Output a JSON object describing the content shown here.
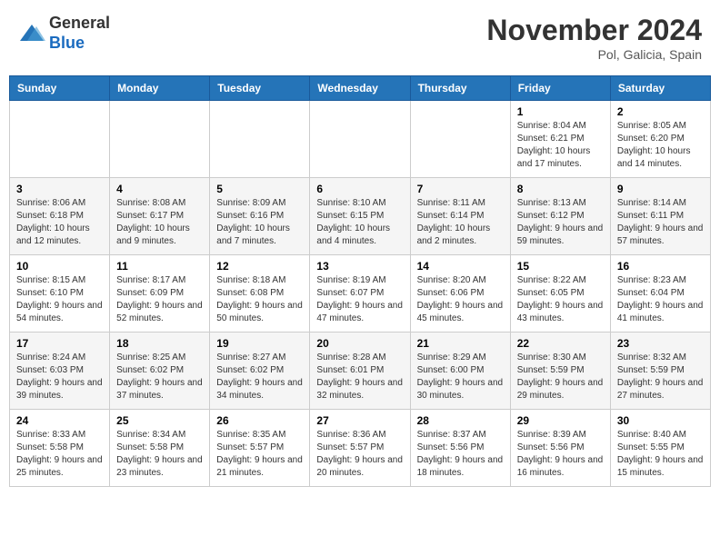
{
  "header": {
    "logo_line1": "General",
    "logo_line2": "Blue",
    "month_title": "November 2024",
    "location": "Pol, Galicia, Spain"
  },
  "weekdays": [
    "Sunday",
    "Monday",
    "Tuesday",
    "Wednesday",
    "Thursday",
    "Friday",
    "Saturday"
  ],
  "weeks": [
    [
      {
        "day": "",
        "info": ""
      },
      {
        "day": "",
        "info": ""
      },
      {
        "day": "",
        "info": ""
      },
      {
        "day": "",
        "info": ""
      },
      {
        "day": "",
        "info": ""
      },
      {
        "day": "1",
        "info": "Sunrise: 8:04 AM\nSunset: 6:21 PM\nDaylight: 10 hours and 17 minutes."
      },
      {
        "day": "2",
        "info": "Sunrise: 8:05 AM\nSunset: 6:20 PM\nDaylight: 10 hours and 14 minutes."
      }
    ],
    [
      {
        "day": "3",
        "info": "Sunrise: 8:06 AM\nSunset: 6:18 PM\nDaylight: 10 hours and 12 minutes."
      },
      {
        "day": "4",
        "info": "Sunrise: 8:08 AM\nSunset: 6:17 PM\nDaylight: 10 hours and 9 minutes."
      },
      {
        "day": "5",
        "info": "Sunrise: 8:09 AM\nSunset: 6:16 PM\nDaylight: 10 hours and 7 minutes."
      },
      {
        "day": "6",
        "info": "Sunrise: 8:10 AM\nSunset: 6:15 PM\nDaylight: 10 hours and 4 minutes."
      },
      {
        "day": "7",
        "info": "Sunrise: 8:11 AM\nSunset: 6:14 PM\nDaylight: 10 hours and 2 minutes."
      },
      {
        "day": "8",
        "info": "Sunrise: 8:13 AM\nSunset: 6:12 PM\nDaylight: 9 hours and 59 minutes."
      },
      {
        "day": "9",
        "info": "Sunrise: 8:14 AM\nSunset: 6:11 PM\nDaylight: 9 hours and 57 minutes."
      }
    ],
    [
      {
        "day": "10",
        "info": "Sunrise: 8:15 AM\nSunset: 6:10 PM\nDaylight: 9 hours and 54 minutes."
      },
      {
        "day": "11",
        "info": "Sunrise: 8:17 AM\nSunset: 6:09 PM\nDaylight: 9 hours and 52 minutes."
      },
      {
        "day": "12",
        "info": "Sunrise: 8:18 AM\nSunset: 6:08 PM\nDaylight: 9 hours and 50 minutes."
      },
      {
        "day": "13",
        "info": "Sunrise: 8:19 AM\nSunset: 6:07 PM\nDaylight: 9 hours and 47 minutes."
      },
      {
        "day": "14",
        "info": "Sunrise: 8:20 AM\nSunset: 6:06 PM\nDaylight: 9 hours and 45 minutes."
      },
      {
        "day": "15",
        "info": "Sunrise: 8:22 AM\nSunset: 6:05 PM\nDaylight: 9 hours and 43 minutes."
      },
      {
        "day": "16",
        "info": "Sunrise: 8:23 AM\nSunset: 6:04 PM\nDaylight: 9 hours and 41 minutes."
      }
    ],
    [
      {
        "day": "17",
        "info": "Sunrise: 8:24 AM\nSunset: 6:03 PM\nDaylight: 9 hours and 39 minutes."
      },
      {
        "day": "18",
        "info": "Sunrise: 8:25 AM\nSunset: 6:02 PM\nDaylight: 9 hours and 37 minutes."
      },
      {
        "day": "19",
        "info": "Sunrise: 8:27 AM\nSunset: 6:02 PM\nDaylight: 9 hours and 34 minutes."
      },
      {
        "day": "20",
        "info": "Sunrise: 8:28 AM\nSunset: 6:01 PM\nDaylight: 9 hours and 32 minutes."
      },
      {
        "day": "21",
        "info": "Sunrise: 8:29 AM\nSunset: 6:00 PM\nDaylight: 9 hours and 30 minutes."
      },
      {
        "day": "22",
        "info": "Sunrise: 8:30 AM\nSunset: 5:59 PM\nDaylight: 9 hours and 29 minutes."
      },
      {
        "day": "23",
        "info": "Sunrise: 8:32 AM\nSunset: 5:59 PM\nDaylight: 9 hours and 27 minutes."
      }
    ],
    [
      {
        "day": "24",
        "info": "Sunrise: 8:33 AM\nSunset: 5:58 PM\nDaylight: 9 hours and 25 minutes."
      },
      {
        "day": "25",
        "info": "Sunrise: 8:34 AM\nSunset: 5:58 PM\nDaylight: 9 hours and 23 minutes."
      },
      {
        "day": "26",
        "info": "Sunrise: 8:35 AM\nSunset: 5:57 PM\nDaylight: 9 hours and 21 minutes."
      },
      {
        "day": "27",
        "info": "Sunrise: 8:36 AM\nSunset: 5:57 PM\nDaylight: 9 hours and 20 minutes."
      },
      {
        "day": "28",
        "info": "Sunrise: 8:37 AM\nSunset: 5:56 PM\nDaylight: 9 hours and 18 minutes."
      },
      {
        "day": "29",
        "info": "Sunrise: 8:39 AM\nSunset: 5:56 PM\nDaylight: 9 hours and 16 minutes."
      },
      {
        "day": "30",
        "info": "Sunrise: 8:40 AM\nSunset: 5:55 PM\nDaylight: 9 hours and 15 minutes."
      }
    ]
  ]
}
